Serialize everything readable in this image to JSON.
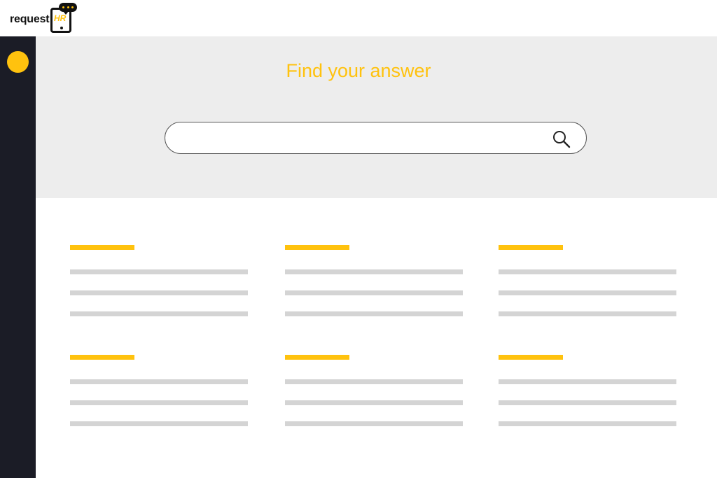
{
  "brand": {
    "logo_text": "request",
    "logo_badge_text": "HR",
    "accent_color": "#FFC20E",
    "sidebar_color": "#1b1c26",
    "hero_color": "#ededed"
  },
  "hero": {
    "title": "Find your answer"
  },
  "search": {
    "value": "",
    "placeholder": "",
    "icon": "search-icon"
  },
  "sidebar": {
    "items": [
      {
        "icon": "yellow-dot-icon"
      }
    ]
  },
  "content": {
    "cards": [
      {
        "title": "",
        "lines": [
          "",
          "",
          ""
        ]
      },
      {
        "title": "",
        "lines": [
          "",
          "",
          ""
        ]
      },
      {
        "title": "",
        "lines": [
          "",
          "",
          ""
        ]
      },
      {
        "title": "",
        "lines": [
          "",
          "",
          ""
        ]
      },
      {
        "title": "",
        "lines": [
          "",
          "",
          ""
        ]
      },
      {
        "title": "",
        "lines": [
          "",
          "",
          ""
        ]
      }
    ]
  }
}
